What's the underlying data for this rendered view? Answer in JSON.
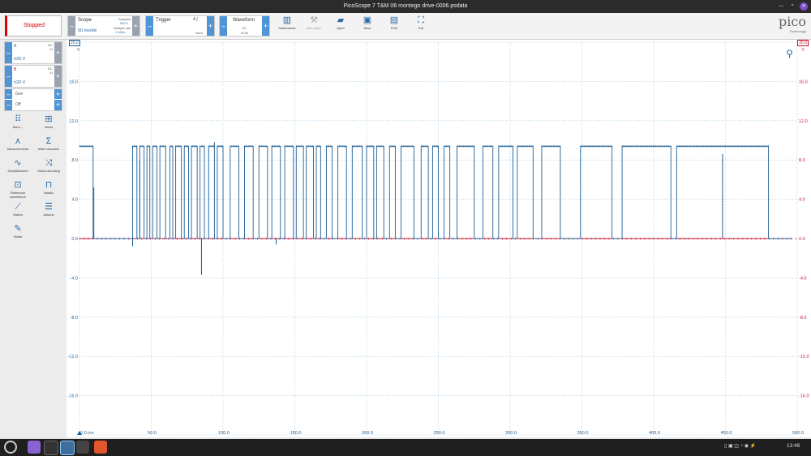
{
  "window": {
    "title": "PicoScope 7 T&M 06 montego drive-0006.psdata"
  },
  "toolbar": {
    "stop_label": "Stopped",
    "scope": {
      "title": "Scope",
      "timebase": "50 ms/div",
      "samples_label": "Samples",
      "samples_value": "500 k",
      "sample_rate_label": "Sample rate",
      "sample_rate_value": "1 MS/s"
    },
    "trigger": {
      "title": "Trigger",
      "mode": "None"
    },
    "waveform": {
      "title": "Waveform",
      "current": "53",
      "total": "of 64"
    },
    "items": [
      {
        "label": "Instruments",
        "icon": "instruments-icon"
      },
      {
        "label": "Auto setup",
        "icon": "wand-icon"
      },
      {
        "label": "Open",
        "icon": "folder-icon"
      },
      {
        "label": "Save",
        "icon": "save-icon"
      },
      {
        "label": "Print",
        "icon": "print-icon"
      },
      {
        "label": "Full",
        "icon": "fullscreen-icon"
      }
    ],
    "logo": {
      "text": "pico",
      "sub": "Technology"
    }
  },
  "channels": [
    {
      "name": "A",
      "coupling": "DC",
      "probe": "x1",
      "range": "±20 V",
      "color": "#1f5f94"
    },
    {
      "name": "B",
      "coupling": "DC",
      "probe": "x1",
      "range": "±20 V",
      "color": "#c8102e"
    }
  ],
  "generator": {
    "label": "Gen",
    "state": "Off"
  },
  "tools": [
    {
      "label": "More...",
      "icon": "more-icon"
    },
    {
      "label": "Views",
      "icon": "views-icon"
    },
    {
      "label": "Measurements",
      "icon": "measurements-icon"
    },
    {
      "label": "Math channels",
      "icon": "sigma-icon"
    },
    {
      "label": "DeepMeasure",
      "icon": "deepmeasure-icon"
    },
    {
      "label": "Serial decoding",
      "icon": "serial-icon"
    },
    {
      "label": "Reference waveforms",
      "icon": "reference-icon"
    },
    {
      "label": "Masks",
      "icon": "masks-icon"
    },
    {
      "label": "Rulers",
      "icon": "rulers-icon"
    },
    {
      "label": "Actions",
      "icon": "actions-icon"
    },
    {
      "label": "Notes",
      "icon": "notes-icon"
    }
  ],
  "plot": {
    "left_unit": "V",
    "right_unit": "V",
    "left_range": "20.0",
    "right_range": "20.0",
    "x_first_label": "0.0 ms",
    "colors": {
      "channel_a": "#1f5f94",
      "channel_b": "#c8102e",
      "grid": "#9fc6e0"
    }
  },
  "chart_data": {
    "type": "line",
    "x_ticks": [
      "0.0 ms",
      "50.0",
      "100.0",
      "150.0",
      "200.0",
      "250.0",
      "300.0",
      "350.0",
      "400.0",
      "450.0",
      "500.0"
    ],
    "y_ticks": [
      "20.0",
      "16.0",
      "12.0",
      "8.0",
      "4.0",
      "0.0",
      "-4.0",
      "-8.0",
      "-12.0",
      "-16.0",
      "-20.0"
    ],
    "xlim": [
      0,
      500
    ],
    "ylim": [
      -20,
      20
    ],
    "grid": true,
    "series": [
      {
        "name": "A",
        "color": "#1f5f94",
        "high_level": 9.4,
        "low_level": 0.0,
        "high_spans": [
          [
            0,
            9.5
          ],
          [
            37,
            40
          ],
          [
            42,
            45
          ],
          [
            47,
            49
          ],
          [
            51,
            54
          ],
          [
            56,
            60
          ],
          [
            63,
            65
          ],
          [
            67,
            71
          ],
          [
            73,
            76
          ],
          [
            78,
            82
          ],
          [
            84,
            87
          ],
          [
            90,
            94
          ],
          [
            96,
            100
          ],
          [
            105,
            111
          ],
          [
            115,
            121
          ],
          [
            125,
            131
          ],
          [
            134,
            140
          ],
          [
            143,
            149
          ],
          [
            151,
            156
          ],
          [
            158,
            163
          ],
          [
            165,
            168
          ],
          [
            172,
            176
          ],
          [
            180,
            186
          ],
          [
            190,
            197
          ],
          [
            200,
            205
          ],
          [
            207,
            212
          ],
          [
            216,
            220
          ],
          [
            224,
            233
          ],
          [
            238,
            243
          ],
          [
            246,
            250
          ],
          [
            254,
            258
          ],
          [
            263,
            275
          ],
          [
            281,
            288
          ],
          [
            292,
            302
          ],
          [
            305,
            316
          ],
          [
            322,
            335
          ],
          [
            349,
            371
          ],
          [
            378,
            412
          ],
          [
            416,
            480
          ]
        ],
        "spikes": [
          [
            10,
            5.2
          ],
          [
            37,
            -0.8
          ],
          [
            42,
            8.0
          ],
          [
            94,
            9.8
          ],
          [
            137,
            -0.6
          ],
          [
            448,
            8.6
          ]
        ]
      },
      {
        "name": "B",
        "color": "#c8102e",
        "baseline": 0.0,
        "spikes": [
          [
            85,
            -3.7
          ]
        ]
      }
    ]
  },
  "taskbar": {
    "time": "13:48"
  }
}
